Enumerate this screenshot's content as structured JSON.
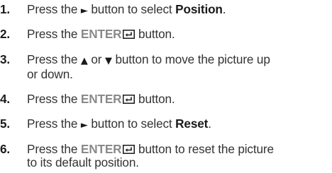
{
  "steps": [
    {
      "number": "1.",
      "parts": {
        "a": "Press the ",
        "glyph": "►",
        "b": " button to select ",
        "bold": "Position",
        "c": "."
      }
    },
    {
      "number": "2.",
      "parts": {
        "a": "Press the ",
        "key": "ENTER",
        "b": " button."
      },
      "icon": "enter-key-icon"
    },
    {
      "number": "3.",
      "parts": {
        "a": "Press the ",
        "glyph1": "▲",
        "b": " or ",
        "glyph2": "▼",
        "c": " button to move the picture up",
        "d": "or down."
      }
    },
    {
      "number": "4.",
      "parts": {
        "a": "Press the ",
        "key": "ENTER",
        "b": " button."
      },
      "icon": "enter-key-icon"
    },
    {
      "number": "5.",
      "parts": {
        "a": "Press the ",
        "glyph": "►",
        "b": " button to select ",
        "bold": "Reset",
        "c": "."
      }
    },
    {
      "number": "6.",
      "parts": {
        "a": "Press the ",
        "key": "ENTER",
        "b": " button to reset the picture",
        "c": "to its default position."
      },
      "icon": "enter-key-icon"
    }
  ],
  "colors": {
    "text": "#333333",
    "key": "#8a8a8a",
    "number": "#1a1a1a"
  }
}
